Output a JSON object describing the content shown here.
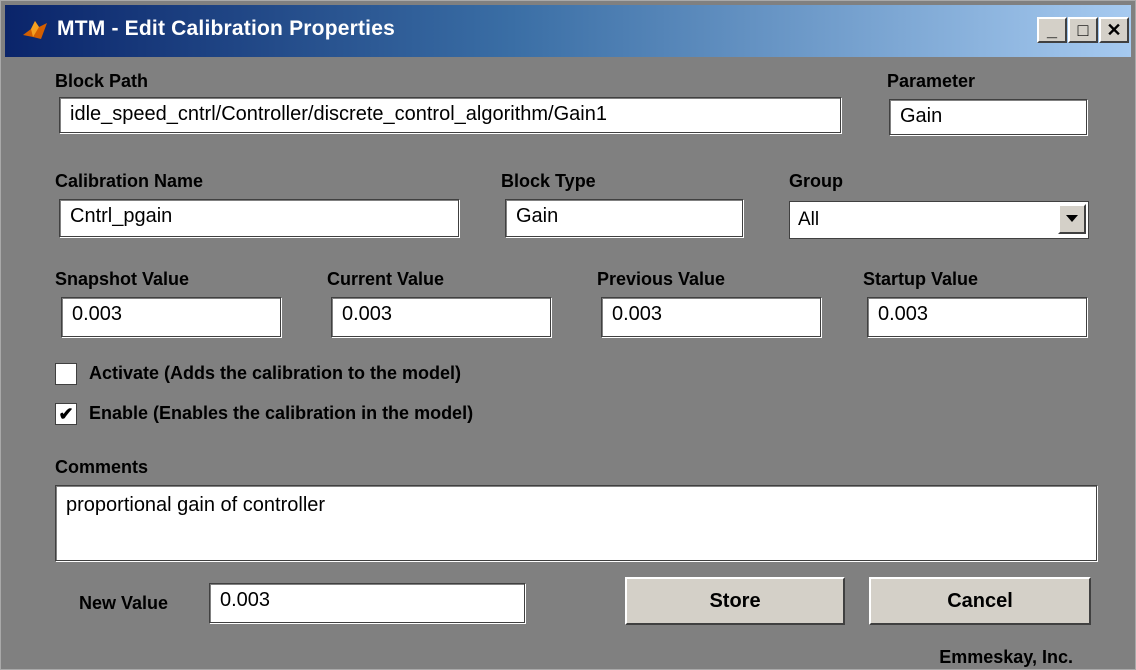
{
  "window": {
    "title": "MTM - Edit Calibration Properties"
  },
  "labels": {
    "block_path": "Block Path",
    "parameter": "Parameter",
    "calibration_name": "Calibration Name",
    "block_type": "Block Type",
    "group": "Group",
    "snapshot_value": "Snapshot Value",
    "current_value": "Current Value",
    "previous_value": "Previous Value",
    "startup_value": "Startup Value",
    "comments": "Comments",
    "new_value": "New Value"
  },
  "fields": {
    "block_path": "idle_speed_cntrl/Controller/discrete_control_algorithm/Gain1",
    "parameter": "Gain",
    "calibration_name": "Cntrl_pgain",
    "block_type": "Gain",
    "group": "All",
    "snapshot_value": "0.003",
    "current_value": "0.003",
    "previous_value": "0.003",
    "startup_value": "0.003",
    "comments": "proportional gain of controller",
    "new_value": "0.003"
  },
  "checkboxes": {
    "activate": {
      "label": "Activate (Adds the calibration to the model)",
      "checked": false
    },
    "enable": {
      "label": "Enable (Enables the calibration in the model)",
      "checked": true
    }
  },
  "buttons": {
    "store": "Store",
    "cancel": "Cancel"
  },
  "footer": "Emmeskay, Inc."
}
